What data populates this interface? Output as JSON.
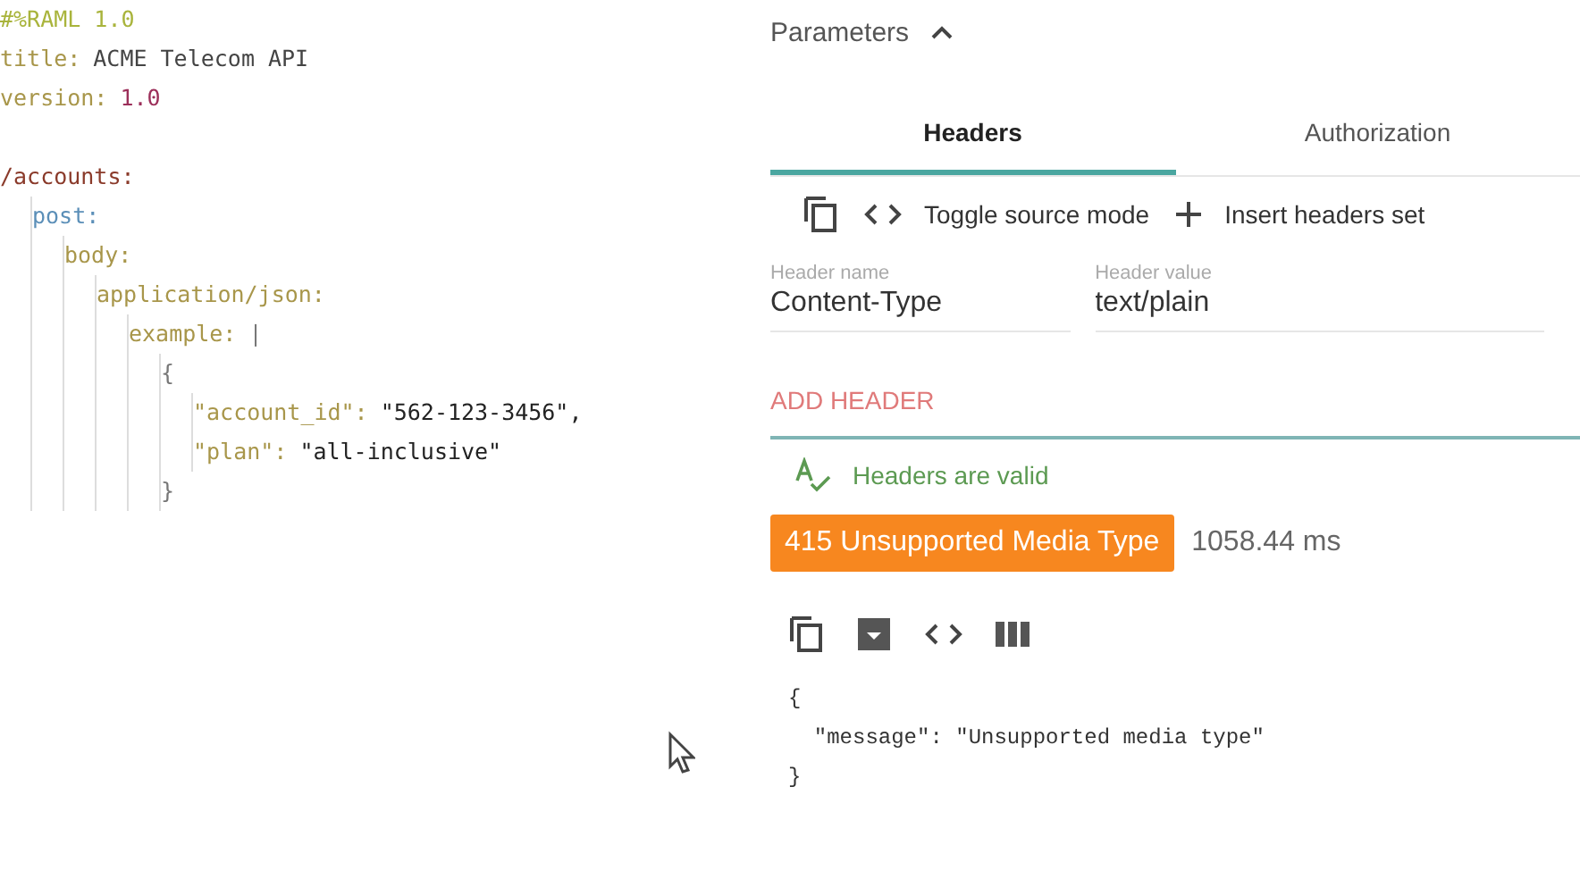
{
  "editor": {
    "lines": [
      {
        "tokens": [
          {
            "kind": "comment",
            "text": "#%RAML 1.0"
          }
        ]
      },
      {
        "tokens": [
          {
            "kind": "key",
            "text": "title:"
          },
          {
            "kind": "plain",
            "text": "ACME Telecom API"
          }
        ]
      },
      {
        "tokens": [
          {
            "kind": "key",
            "text": "version:"
          },
          {
            "kind": "number",
            "text": "1.0"
          }
        ]
      },
      {
        "tokens": [
          {
            "kind": "resource",
            "text": "/accounts:"
          }
        ],
        "children": [
          {
            "tokens": [
              {
                "kind": "method",
                "text": "post:"
              }
            ],
            "children": [
              {
                "tokens": [
                  {
                    "kind": "key",
                    "text": "body:"
                  }
                ],
                "children": [
                  {
                    "tokens": [
                      {
                        "kind": "key",
                        "text": "application/json:"
                      }
                    ],
                    "children": [
                      {
                        "tokens": [
                          {
                            "kind": "key",
                            "text": "example:"
                          },
                          {
                            "kind": "punct",
                            "text": "|"
                          }
                        ],
                        "children": [
                          {
                            "tokens": [
                              {
                                "kind": "punct",
                                "text": "{"
                              }
                            ],
                            "children": [
                              {
                                "tokens": [
                                  {
                                    "kind": "key",
                                    "text": "\"account_id\":"
                                  },
                                  {
                                    "kind": "string",
                                    "text": "\"562-123-3456\","
                                  }
                                ]
                              },
                              {
                                "tokens": [
                                  {
                                    "kind": "key",
                                    "text": "\"plan\":"
                                  },
                                  {
                                    "kind": "string",
                                    "text": "\"all-inclusive\""
                                  }
                                ]
                              }
                            ]
                          },
                          {
                            "tokens": [
                              {
                                "kind": "punct",
                                "text": "}"
                              }
                            ]
                          }
                        ]
                      }
                    ]
                  }
                ]
              }
            ]
          }
        ]
      }
    ]
  },
  "panel": {
    "title": "Parameters",
    "expanded": true,
    "tabs": [
      {
        "label": "Headers",
        "selected": true
      },
      {
        "label": "Authorization",
        "selected": false
      }
    ],
    "toolbar": [
      {
        "kind": "copy"
      },
      {
        "kind": "code",
        "label": "Toggle source mode"
      },
      {
        "kind": "add",
        "label": "Insert headers set"
      }
    ],
    "header": {
      "name_label": "Header name",
      "name": "Content-Type",
      "value_label": "Header value",
      "value": "text/plain"
    },
    "add_button": "ADD HEADER",
    "validation": {
      "valid": true,
      "text": "Headers are valid"
    },
    "status": {
      "text": "415 Unsupported Media Type",
      "color": "#f7871f",
      "time": "1058.44 ms"
    },
    "response_tools": [
      {
        "kind": "copy"
      },
      {
        "kind": "save"
      },
      {
        "kind": "code"
      },
      {
        "kind": "columns"
      }
    ],
    "response": [
      "{",
      "  \"message\": \"Unsupported media type\"",
      "}"
    ]
  }
}
